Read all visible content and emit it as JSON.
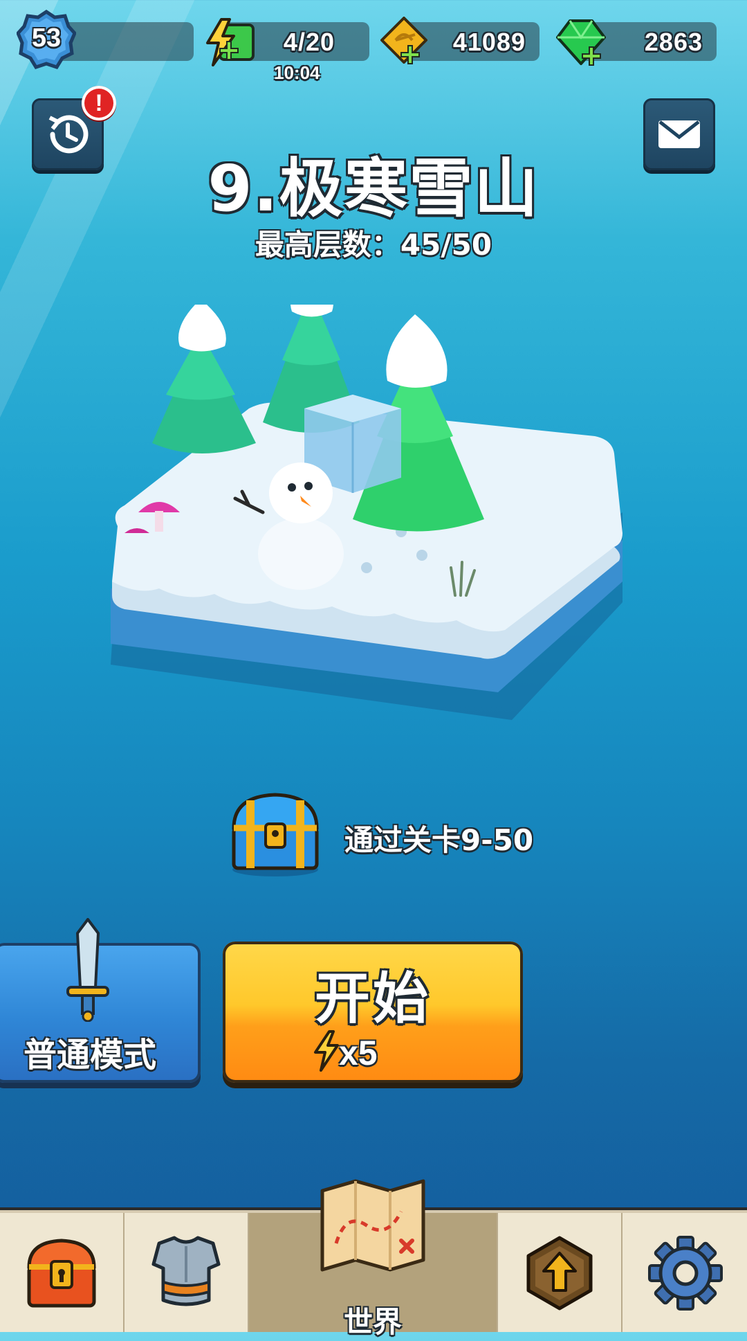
{
  "header": {
    "player_level": "53",
    "energy": "4/20",
    "energy_timer": "10:04",
    "gold": "41089",
    "gems": "2863",
    "notification_badge": "!"
  },
  "stage": {
    "title": "9.极寒雪山",
    "best_floor": "最高层数：45/50"
  },
  "reward": {
    "text": "通过关卡9-50"
  },
  "buttons": {
    "mode_label": "普通模式",
    "start_label": "开始",
    "start_cost": "x5"
  },
  "bottom_nav": {
    "items": [
      {
        "icon": "chest-icon",
        "label": ""
      },
      {
        "icon": "armor-icon",
        "label": ""
      },
      {
        "icon": "world-map-icon",
        "label": "世界",
        "active": true
      },
      {
        "icon": "upgrade-icon",
        "label": ""
      },
      {
        "icon": "gear-icon",
        "label": ""
      }
    ]
  },
  "colors": {
    "sky_top": "#6fd6ec",
    "water_bottom": "#14589a",
    "start_button": "#ffc82b",
    "mode_button": "#2f86d6",
    "energy_green": "#3cc84a",
    "gem_green": "#27c94f",
    "gold": "#f2b41c"
  }
}
